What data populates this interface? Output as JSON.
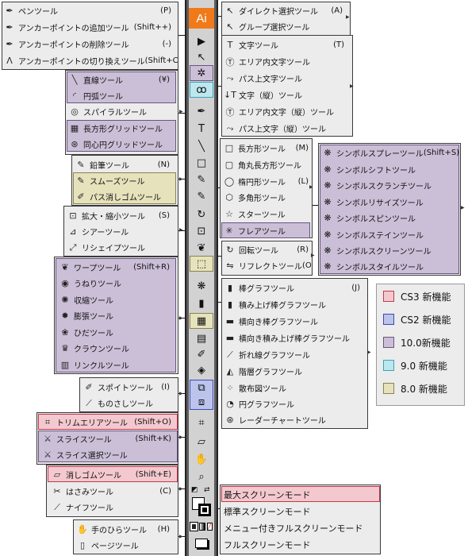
{
  "app_logo": "Ai",
  "groups": {
    "pen": [
      {
        "icon": "✒",
        "label": "ペンツール",
        "shortcut": "(P)"
      },
      {
        "icon": "✒",
        "label": "アンカーポイントの追加ツール",
        "shortcut": "(Shift++)"
      },
      {
        "icon": "✒",
        "label": "アンカーポイントの削除ツール",
        "shortcut": "(-)"
      },
      {
        "icon": "ᐱ",
        "label": "アンカーポイントの切り換えツール",
        "shortcut": "(Shift+C)"
      }
    ],
    "line": [
      {
        "icon": "╲",
        "label": "直線ツール",
        "shortcut": "(¥)"
      },
      {
        "icon": "◜",
        "label": "円弧ツール",
        "shortcut": ""
      },
      {
        "icon": "◎",
        "label": "スパイラルツール",
        "shortcut": ""
      },
      {
        "icon": "▦",
        "label": "長方形グリッドツール",
        "shortcut": ""
      },
      {
        "icon": "⊛",
        "label": "同心円グリッドツール",
        "shortcut": ""
      }
    ],
    "pencil": [
      {
        "icon": "✎",
        "label": "鉛筆ツール",
        "shortcut": "(N)"
      },
      {
        "icon": "✎",
        "label": "スムーズツール",
        "shortcut": ""
      },
      {
        "icon": "✐",
        "label": "パス消しゴムツール",
        "shortcut": ""
      }
    ],
    "scale": [
      {
        "icon": "⊡",
        "label": "拡大・縮小ツール",
        "shortcut": "(S)"
      },
      {
        "icon": "⊿",
        "label": "シアーツール",
        "shortcut": ""
      },
      {
        "icon": "⤢",
        "label": "リシェイプツール",
        "shortcut": ""
      }
    ],
    "warp": [
      {
        "icon": "❦",
        "label": "ワープツール",
        "shortcut": "(Shift+R)"
      },
      {
        "icon": "◉",
        "label": "うねりツール",
        "shortcut": ""
      },
      {
        "icon": "✺",
        "label": "収縮ツール",
        "shortcut": ""
      },
      {
        "icon": "✹",
        "label": "膨張ツール",
        "shortcut": ""
      },
      {
        "icon": "❀",
        "label": "ひだツール",
        "shortcut": ""
      },
      {
        "icon": "♛",
        "label": "クラウンツール",
        "shortcut": ""
      },
      {
        "icon": "▥",
        "label": "リンクルツール",
        "shortcut": ""
      }
    ],
    "eyedropper": [
      {
        "icon": "✐",
        "label": "スポイトツール",
        "shortcut": "(I)"
      },
      {
        "icon": "⟋",
        "label": "ものさしツール",
        "shortcut": ""
      }
    ],
    "slice": [
      {
        "icon": "⌗",
        "label": "トリムエリアツール",
        "shortcut": "(Shift+O)"
      },
      {
        "icon": "⚔",
        "label": "スライスツール",
        "shortcut": "(Shift+K)"
      },
      {
        "icon": "⚔",
        "label": "スライス選択ツール",
        "shortcut": ""
      }
    ],
    "eraser": [
      {
        "icon": "▱",
        "label": "消しゴムツール",
        "shortcut": "(Shift+E)"
      },
      {
        "icon": "✂",
        "label": "はさみツール",
        "shortcut": "(C)"
      },
      {
        "icon": "⟋",
        "label": "ナイフツール",
        "shortcut": ""
      }
    ],
    "hand": [
      {
        "icon": "✋",
        "label": "手のひらツール",
        "shortcut": "(H)"
      },
      {
        "icon": "▯",
        "label": "ページツール",
        "shortcut": ""
      }
    ],
    "direct": [
      {
        "icon": "↖",
        "label": "ダイレクト選択ツール",
        "shortcut": "(A)"
      },
      {
        "icon": "↖",
        "label": "グループ選択ツール",
        "shortcut": ""
      }
    ],
    "type": [
      {
        "icon": "T",
        "label": "文字ツール",
        "shortcut": "(T)"
      },
      {
        "icon": "Ⓣ",
        "label": "エリア内文字ツール",
        "shortcut": ""
      },
      {
        "icon": "⤳",
        "label": "パス上文字ツール",
        "shortcut": ""
      },
      {
        "icon": "↓T",
        "label": "文字（縦）ツール",
        "shortcut": ""
      },
      {
        "icon": "Ⓣ",
        "label": "エリア内文字（縦）ツール",
        "shortcut": ""
      },
      {
        "icon": "⤳",
        "label": "パス上文字（縦）ツール",
        "shortcut": ""
      }
    ],
    "rect": [
      {
        "icon": "□",
        "label": "長方形ツール",
        "shortcut": "(M)"
      },
      {
        "icon": "▢",
        "label": "角丸長方形ツール",
        "shortcut": ""
      },
      {
        "icon": "◯",
        "label": "楕円形ツール",
        "shortcut": "(L)"
      },
      {
        "icon": "⬡",
        "label": "多角形ツール",
        "shortcut": ""
      },
      {
        "icon": "☆",
        "label": "スターツール",
        "shortcut": ""
      },
      {
        "icon": "✳",
        "label": "フレアツール",
        "shortcut": ""
      }
    ],
    "rotate": [
      {
        "icon": "↻",
        "label": "回転ツール",
        "shortcut": "(R)"
      },
      {
        "icon": "⇋",
        "label": "リフレクトツール",
        "shortcut": "(O)"
      }
    ],
    "symbol": [
      {
        "icon": "❋",
        "label": "シンボルスプレーツール",
        "shortcut": "(Shift+S)"
      },
      {
        "icon": "❋",
        "label": "シンボルシフトツール",
        "shortcut": ""
      },
      {
        "icon": "❋",
        "label": "シンボルスクランチツール",
        "shortcut": ""
      },
      {
        "icon": "❋",
        "label": "シンボルリサイズツール",
        "shortcut": ""
      },
      {
        "icon": "❋",
        "label": "シンボルスピンツール",
        "shortcut": ""
      },
      {
        "icon": "❋",
        "label": "シンボルステインツール",
        "shortcut": ""
      },
      {
        "icon": "❋",
        "label": "シンボルスクリーンツール",
        "shortcut": ""
      },
      {
        "icon": "❋",
        "label": "シンボルスタイルツール",
        "shortcut": ""
      }
    ],
    "graph": [
      {
        "icon": "▮",
        "label": "棒グラフツール",
        "shortcut": "(J)"
      },
      {
        "icon": "▮",
        "label": "積み上げ棒グラフツール",
        "shortcut": ""
      },
      {
        "icon": "▬",
        "label": "横向き棒グラフツール",
        "shortcut": ""
      },
      {
        "icon": "▬",
        "label": "横向き積み上げ棒グラフツール",
        "shortcut": ""
      },
      {
        "icon": "⟋",
        "label": "折れ線グラフツール",
        "shortcut": ""
      },
      {
        "icon": "◭",
        "label": "階層グラフツール",
        "shortcut": ""
      },
      {
        "icon": "⁘",
        "label": "散布図ツール",
        "shortcut": ""
      },
      {
        "icon": "◔",
        "label": "円グラフツール",
        "shortcut": ""
      },
      {
        "icon": "⊛",
        "label": "レーダーチャートツール",
        "shortcut": ""
      }
    ],
    "screen": [
      {
        "icon": "",
        "label": "最大スクリーンモード",
        "shortcut": ""
      },
      {
        "icon": "",
        "label": "標準スクリーンモード",
        "shortcut": ""
      },
      {
        "icon": "",
        "label": "メニュー付きフルスクリーンモード",
        "shortcut": ""
      },
      {
        "icon": "",
        "label": "フルスクリーンモード",
        "shortcut": ""
      }
    ]
  },
  "toolbar": [
    {
      "icon": "▶",
      "name": "selection-tool"
    },
    {
      "icon": "↖",
      "name": "direct-selection-tool"
    },
    {
      "icon": "✲",
      "name": "magic-wand-tool"
    },
    {
      "icon": "ꝏ",
      "name": "lasso-tool"
    },
    {
      "icon": "✒",
      "name": "pen-tool"
    },
    {
      "icon": "T",
      "name": "type-tool"
    },
    {
      "icon": "╲",
      "name": "line-tool"
    },
    {
      "icon": "□",
      "name": "rectangle-tool"
    },
    {
      "icon": "✎",
      "name": "paintbrush-tool"
    },
    {
      "icon": "✎",
      "name": "pencil-tool"
    },
    {
      "icon": "↻",
      "name": "rotate-tool"
    },
    {
      "icon": "⊡",
      "name": "scale-tool"
    },
    {
      "icon": "❦",
      "name": "warp-tool"
    },
    {
      "icon": "⬚",
      "name": "free-transform-tool"
    },
    {
      "icon": "❋",
      "name": "symbol-sprayer-tool"
    },
    {
      "icon": "▮",
      "name": "graph-tool"
    },
    {
      "icon": "▦",
      "name": "mesh-tool"
    },
    {
      "icon": "▤",
      "name": "gradient-tool"
    },
    {
      "icon": "✐",
      "name": "eyedropper-tool"
    },
    {
      "icon": "◈",
      "name": "blend-tool"
    },
    {
      "icon": "⧉",
      "name": "live-paint-bucket-tool"
    },
    {
      "icon": "⧈",
      "name": "live-paint-selection-tool"
    },
    {
      "icon": "⌗",
      "name": "crop-area-tool"
    },
    {
      "icon": "▱",
      "name": "eraser-tool"
    },
    {
      "icon": "✋",
      "name": "hand-tool"
    },
    {
      "icon": "⌕",
      "name": "zoom-tool"
    }
  ],
  "legend": [
    {
      "label": "CS3 新機能",
      "color": "#f3c9cf",
      "border": "#c43a4a"
    },
    {
      "label": "CS2 新機能",
      "color": "#bcc4ec",
      "border": "#3c49b4"
    },
    {
      "label": "10.0新機能",
      "color": "#cbbfd7",
      "border": "#6a5480"
    },
    {
      "label": "9.0 新機能",
      "color": "#bde7ef",
      "border": "#3da2b8"
    },
    {
      "label": "8.0 新機能",
      "color": "#e6e2bc",
      "border": "#8a8350"
    }
  ]
}
